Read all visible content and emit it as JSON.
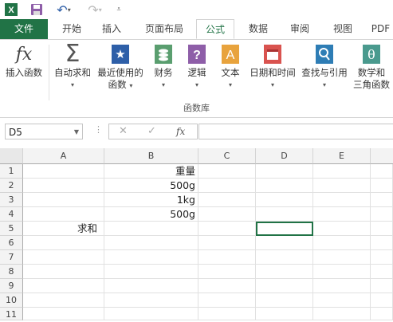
{
  "tabs": {
    "file": "文件",
    "home": "开始",
    "insert": "插入",
    "page_layout": "页面布局",
    "formulas": "公式",
    "data": "数据",
    "review": "审阅",
    "view": "视图",
    "pdf": "PDF"
  },
  "ribbon": {
    "insert_function": "插入函数",
    "autosum": "自动求和",
    "recent_line1": "最近使用的",
    "recent_line2": "函数",
    "financial": "财务",
    "logical": "逻辑",
    "text": "文本",
    "datetime": "日期和时间",
    "lookup": "查找与引用",
    "math_line1": "数学和",
    "math_line2": "三角函数",
    "group_label": "函数库"
  },
  "formula_bar": {
    "name_box": "D5",
    "fx_label": "fx",
    "formula": ""
  },
  "sheet": {
    "columns": [
      "A",
      "B",
      "C",
      "D",
      "E"
    ],
    "rows": [
      "1",
      "2",
      "3",
      "4",
      "5",
      "6",
      "7",
      "8",
      "9",
      "10",
      "11"
    ],
    "cells": {
      "B1": "重量",
      "B2": "500g",
      "B3": "1kg",
      "B4": "500g",
      "A5": "求和"
    }
  },
  "colors": {
    "excel_green": "#217346",
    "financial_icon": "#5a9e6f",
    "logical_icon": "#8e5ea8",
    "text_icon": "#e8a33d",
    "datetime_icon": "#d9534f",
    "lookup_icon": "#2e7db5",
    "math_icon": "#4a9a8e"
  }
}
